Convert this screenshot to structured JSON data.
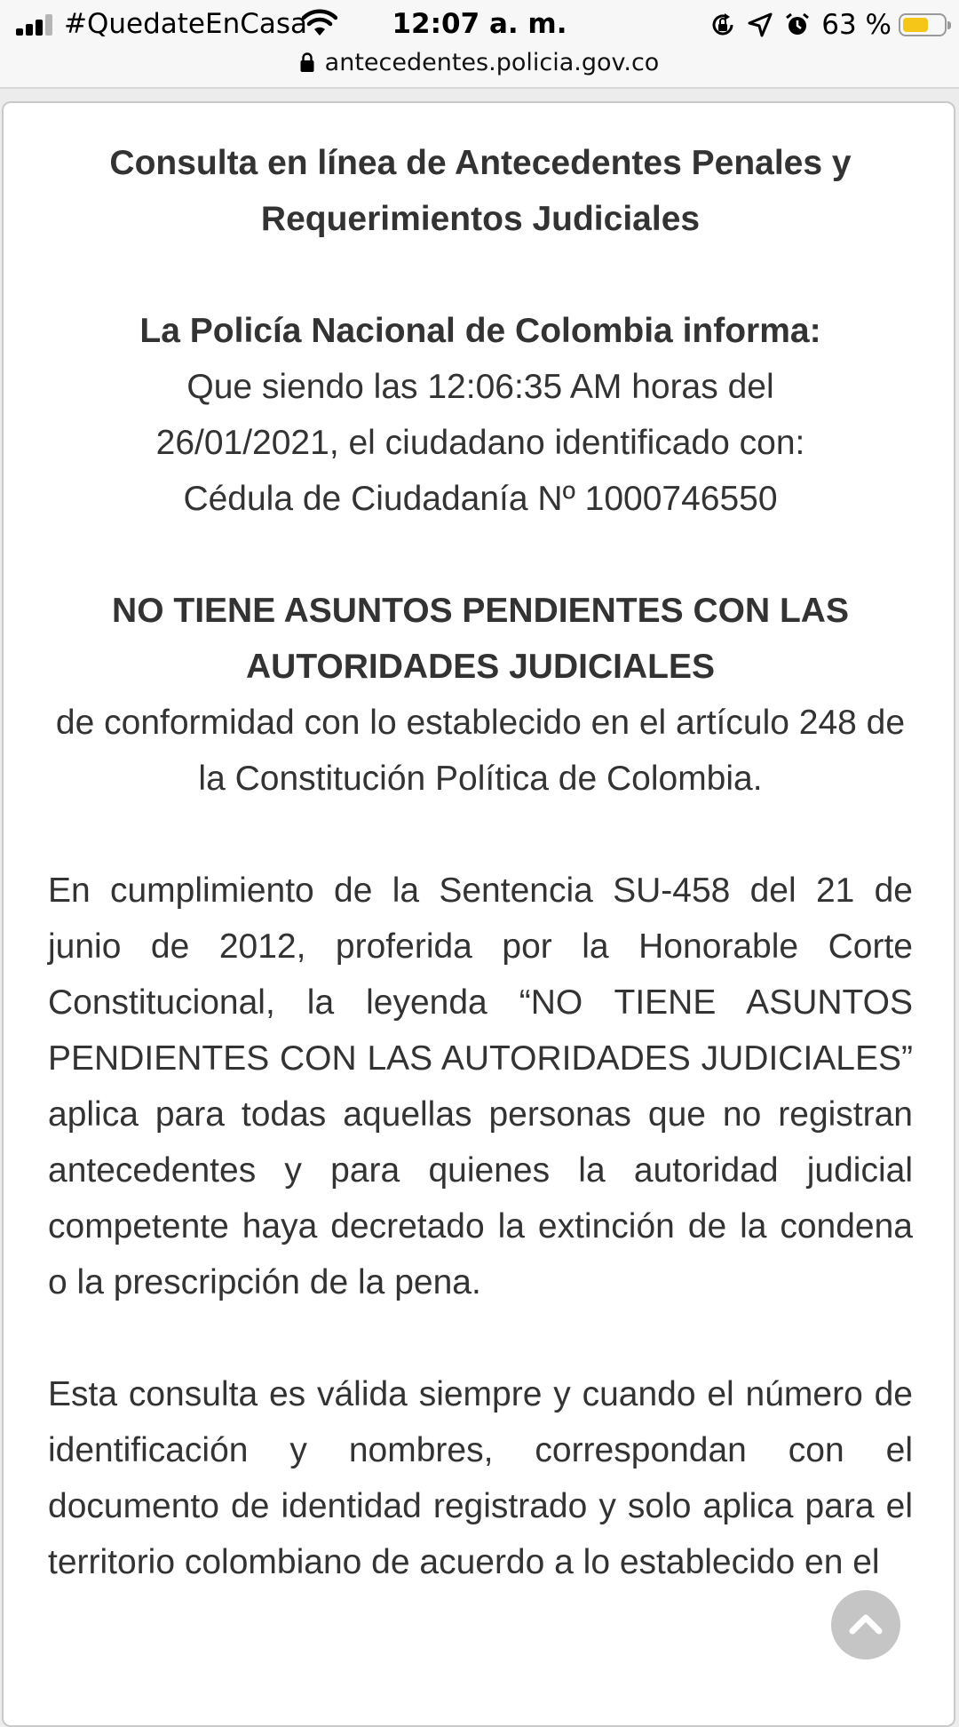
{
  "status_bar": {
    "carrier": "#QuedateEnCasa",
    "time": "12:07 a. m.",
    "battery_percent": "63 %",
    "battery_level": 0.63,
    "battery_color": "#f5c518",
    "icons": [
      "signal-icon",
      "wifi-icon",
      "orientation-lock-icon",
      "location-icon",
      "alarm-icon",
      "battery-icon"
    ]
  },
  "url_bar": {
    "url": "antecedentes.policia.gov.co",
    "icon": "lock-icon"
  },
  "document": {
    "title": "Consulta en línea de Antecedentes Penales y Requerimientos Judiciales",
    "info_heading": "La Policía Nacional de Colombia informa:",
    "info_lines": [
      "Que siendo las 12:06:35 AM horas del",
      "26/01/2021, el ciudadano identificado con:",
      "Cédula de Ciudadanía Nº 1000746550"
    ],
    "result": "NO TIENE ASUNTOS PENDIENTES CON LAS AUTORIDADES JUDICIALES",
    "result_detail": "de conformidad con lo establecido en el artículo 248 de la Constitución Política de Colombia.",
    "paragraph_1": "En cumplimiento de la Sentencia SU-458 del 21 de junio de 2012, proferida por la Honorable Corte Constitucional, la leyenda “NO TIENE ASUNTOS PENDIENTES CON LAS AUTORIDADES JUDICIALES” aplica para todas aquellas personas que no registran antecedentes y para quienes la autoridad judicial competente haya decretado la extinción de la condena o la prescripción de la pena.",
    "paragraph_2": "Esta consulta es válida siempre y cuando el número de identificación y nombres, correspondan con el documento de identidad registrado y solo aplica para el territorio colombiano de acuerdo a lo establecido en el"
  },
  "scroll_top_button": {
    "icon": "chevron-up-icon"
  }
}
